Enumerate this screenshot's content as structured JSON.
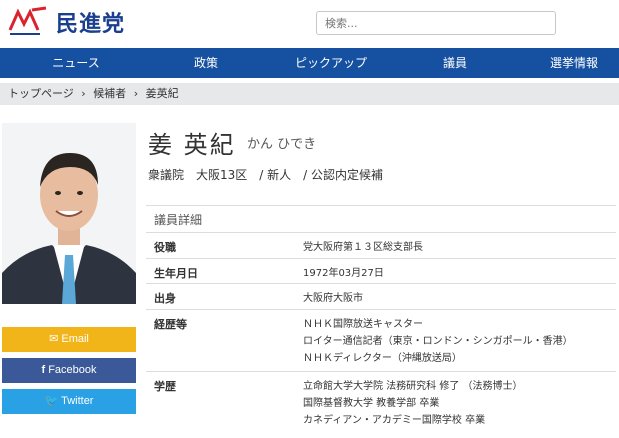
{
  "header": {
    "logo_text": "民進党",
    "search_placeholder": "検索..."
  },
  "nav": {
    "items": [
      "ニュース",
      "政策",
      "ピックアップ",
      "議員",
      "選挙情報"
    ]
  },
  "breadcrumb": {
    "items": [
      "トップページ",
      "›",
      "候補者",
      "›",
      "姜英紀"
    ]
  },
  "profile": {
    "name": "姜 英紀",
    "kana": "かん ひでき",
    "summary": "衆議院　大阪13区　/ 新人　/ 公認内定候補"
  },
  "share": {
    "email": "Email",
    "facebook": "Facebook",
    "twitter": "Twitter"
  },
  "details": {
    "title": "議員詳細",
    "rows": [
      {
        "label": "役職",
        "values": [
          "党大阪府第１３区総支部長"
        ]
      },
      {
        "label": "生年月日",
        "values": [
          "1972年03月27日"
        ]
      },
      {
        "label": "出身",
        "values": [
          "大阪府大阪市"
        ]
      },
      {
        "label": "経歴等",
        "values": [
          "ＮＨＫ国際放送キャスター",
          "ロイター通信記者（東京・ロンドン・シンガポール・香港）",
          "ＮＨＫディレクター（沖縄放送局）"
        ]
      },
      {
        "label": "学歴",
        "values": [
          "立命館大学大学院 法務研究科 修了 （法務博士）",
          "国際基督教大学 教養学部 卒業",
          "カネディアン・アカデミー国際学校 卒業"
        ]
      }
    ]
  },
  "colors": {
    "nav_bg": "#1650a0",
    "email_bg": "#f2b519",
    "facebook_bg": "#3b5998",
    "twitter_bg": "#2ba1e5"
  }
}
